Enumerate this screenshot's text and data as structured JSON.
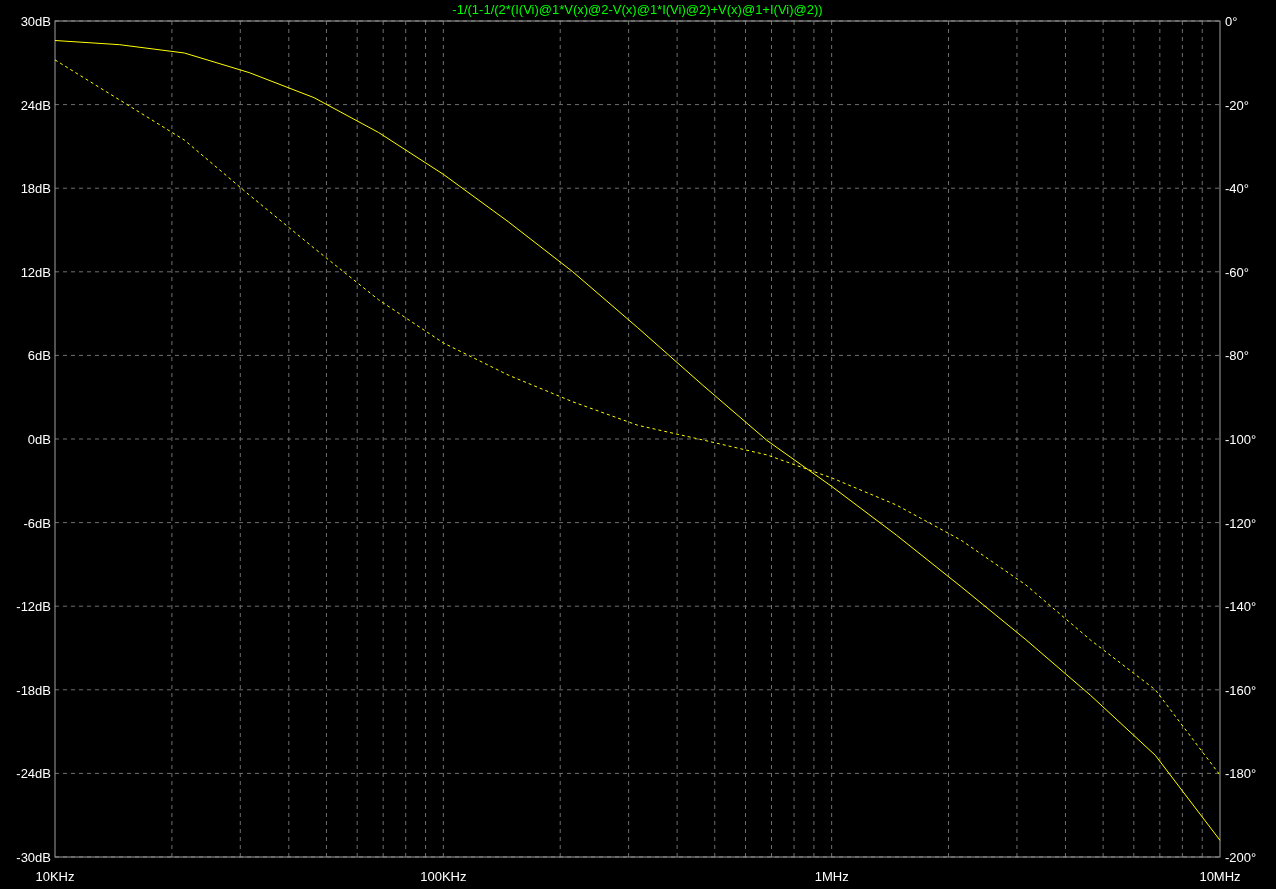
{
  "plot": {
    "chart_data": {
      "type": "line",
      "title": "-1/(1-1/(2*(I(Vi)@1*V(x)@2-V(x)@1*I(Vi)@2)+V(x)@1+I(Vi)@2))",
      "categories": [
        "10KHz",
        null,
        null,
        null,
        null,
        null,
        "100KHz",
        null,
        null,
        null,
        null,
        null,
        "1MHz",
        null,
        null,
        null,
        null,
        null,
        "10MHz"
      ],
      "series": [
        {
          "color": "#ffff00",
          "line_style": "solid",
          "values": [
            28.6,
            28.3,
            27.7,
            26.3,
            24.5,
            22.0,
            19.0,
            15.6,
            12.0,
            8.0,
            3.9,
            -0.1,
            -3.4,
            -6.9,
            -10.6,
            -14.4,
            -18.4,
            -22.7,
            -28.8
          ]
        },
        {
          "color": "#ffff00",
          "line_style": "dashed",
          "axis": "y2",
          "values": [
            -9.3,
            -18.9,
            -28.5,
            -41.6,
            -54.3,
            -66.7,
            -77.0,
            -84.7,
            -91.1,
            -96.7,
            -100.2,
            -103.8,
            -109.3,
            -115.8,
            -124.2,
            -134.9,
            -148.1,
            -160.0,
            -180.4
          ]
        }
      ],
      "grid": true,
      "ylim": [
        -30,
        30
      ],
      "y2lim": [
        -200,
        0
      ],
      "yticks": [
        {
          "value": 30,
          "label": "30dB"
        },
        {
          "value": 24,
          "label": "24dB"
        },
        {
          "value": 18,
          "label": "18dB"
        },
        {
          "value": 12,
          "label": "12dB"
        },
        {
          "value": 6,
          "label": "6dB"
        },
        {
          "value": 0,
          "label": "0dB"
        },
        {
          "value": -6,
          "label": "-6dB"
        },
        {
          "value": -12,
          "label": "-12dB"
        },
        {
          "value": -18,
          "label": "-18dB"
        },
        {
          "value": -24,
          "label": "-24dB"
        },
        {
          "value": -30,
          "label": "-30dB"
        }
      ],
      "y2ticks": [
        {
          "value": 0,
          "label": "0°"
        },
        {
          "value": -20,
          "label": "-20°"
        },
        {
          "value": -40,
          "label": "-40°"
        },
        {
          "value": -60,
          "label": "-60°"
        },
        {
          "value": -80,
          "label": "-80°"
        },
        {
          "value": -100,
          "label": "-100°"
        },
        {
          "value": -120,
          "label": "-120°"
        },
        {
          "value": -140,
          "label": "-140°"
        },
        {
          "value": -160,
          "label": "-160°"
        },
        {
          "value": -180,
          "label": "-180°"
        },
        {
          "value": -200,
          "label": "-200°"
        }
      ]
    }
  }
}
